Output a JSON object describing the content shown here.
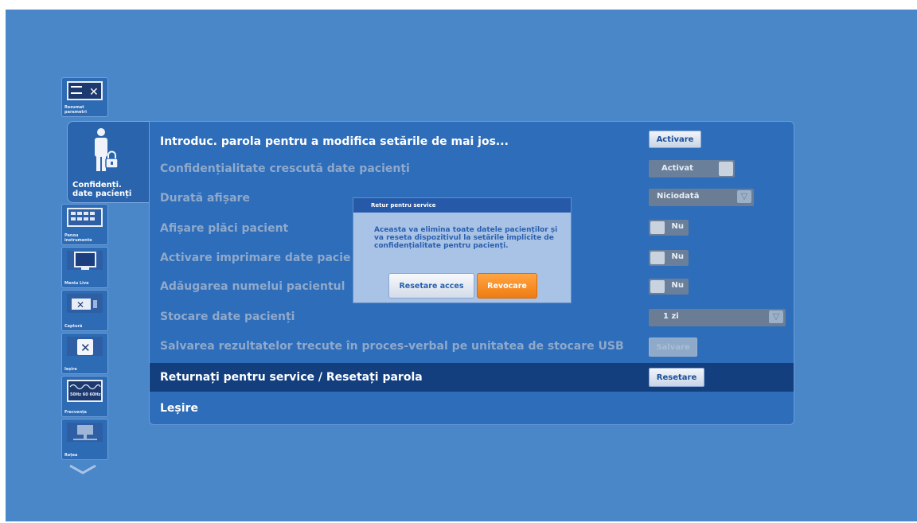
{
  "sidebar": {
    "items": [
      {
        "label": "Rezumat parametri",
        "icon": "parameters-icon"
      },
      {
        "label": "Confidenți. date pacienți",
        "icon": "patient-lock-icon",
        "active": true
      },
      {
        "label": "Panou instrumente",
        "icon": "toolbar-panel-icon"
      },
      {
        "label": "Meniu Live",
        "icon": "monitor-icon"
      },
      {
        "label": "Captură",
        "icon": "capture-icon"
      },
      {
        "label": "Ieșire",
        "icon": "close-icon"
      },
      {
        "label": "Frecvența",
        "icon": "frequency-icon",
        "badge": "50Hz 60 60Hz"
      },
      {
        "label": "Rețea",
        "icon": "network-icon"
      }
    ],
    "scroll_icon": "chevron-down-icon"
  },
  "panel": {
    "rows": [
      {
        "label": "Introduc. parola pentru a modifica setările de mai jos...",
        "control": {
          "type": "button",
          "label": "Activare"
        }
      },
      {
        "label": "Confidențialitate crescută date pacienți",
        "control": {
          "type": "toggle",
          "value": "Activat"
        }
      },
      {
        "label": "Durată afișare",
        "control": {
          "type": "select",
          "value": "Niciodată"
        }
      },
      {
        "label": "Afișare plăci pacient",
        "control": {
          "type": "toggle",
          "value": "Nu"
        }
      },
      {
        "label": "Activare imprimare date pacie",
        "control": {
          "type": "toggle",
          "value": "Nu"
        }
      },
      {
        "label": "Adăugarea numelui pacientul",
        "control": {
          "type": "toggle",
          "value": "Nu"
        }
      },
      {
        "label": "Stocare date pacienți",
        "control": {
          "type": "select",
          "value": "1 zi"
        }
      },
      {
        "label": "Salvarea rezultatelor trecute în proces-verbal pe unitatea de stocare USB",
        "control": {
          "type": "button",
          "label": "Salvare"
        }
      },
      {
        "label": "Returnați pentru service / Resetați parola",
        "control": {
          "type": "button",
          "label": "Resetare"
        }
      },
      {
        "label": "Leșire"
      }
    ]
  },
  "dialog": {
    "title": "Retur pentru service",
    "message": "Aceasta va elimina toate datele pacienților și va reseta dispozitivul la setările implicite de confidențialitate pentru pacienți.",
    "confirm_label": "Resetare acces",
    "cancel_label": "Revocare"
  },
  "colors": {
    "background": "#4a87c9",
    "panel": "#2e6db9",
    "highlight_row": "#143f7f",
    "accent_orange": "#f58a1f"
  }
}
